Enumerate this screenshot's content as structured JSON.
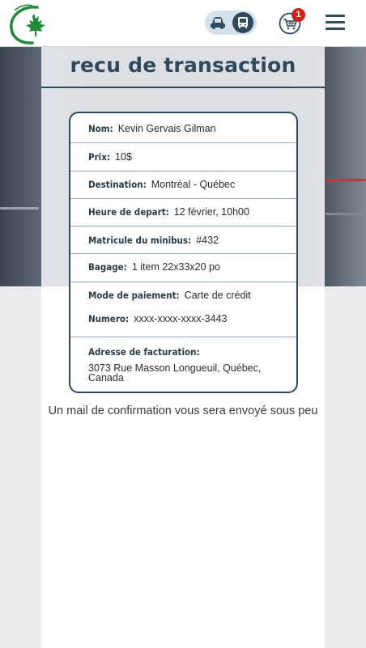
{
  "header": {
    "cart_count": "1",
    "icons": {
      "logo": "maple-leaf-logo",
      "car": "car-icon",
      "bus": "bus-icon",
      "cart": "cart-icon",
      "menu": "hamburger-menu-icon"
    },
    "colors": {
      "brand_green": "#1f8a3a",
      "primary": "#2f4a5c",
      "badge": "#d0221b"
    }
  },
  "page": {
    "title": "recu de transaction"
  },
  "receipt": {
    "nom_label": "Nom:",
    "nom_value": "Kevin Gervais Gilman",
    "prix_label": "Prix:",
    "prix_value": "10$",
    "destination_label": "Destination:",
    "destination_value": "Montréal - Québec",
    "heure_label": "Heure de depart:",
    "heure_value": "12 février, 10h00",
    "matricule_label": "Matricule du minibus:",
    "matricule_value": "#432",
    "bagage_label": "Bagage:",
    "bagage_value": "1 item 22x33x20 po",
    "paiement_label": "Mode de paiement:",
    "paiement_value": "Carte de crédit",
    "numero_label": "Numero:",
    "numero_value": "xxxx-xxxx-xxxx-3443",
    "adresse_label": "Adresse de facturation:",
    "adresse_value": "3073 Rue Masson Longueuil, Québec, Canada"
  },
  "footer": {
    "message": "Un mail de confirmation vous sera envoyé sous peu"
  }
}
